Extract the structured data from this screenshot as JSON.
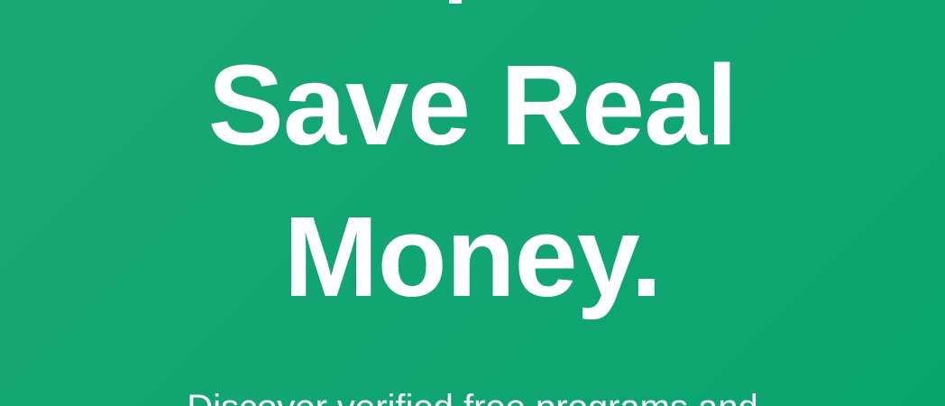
{
  "hero": {
    "headline_line_1": "Save Real",
    "headline_line_2": "Money.",
    "subheadline": "Discover verified free programs and"
  },
  "colors": {
    "background": "#12a572",
    "text": "#ffffff"
  }
}
